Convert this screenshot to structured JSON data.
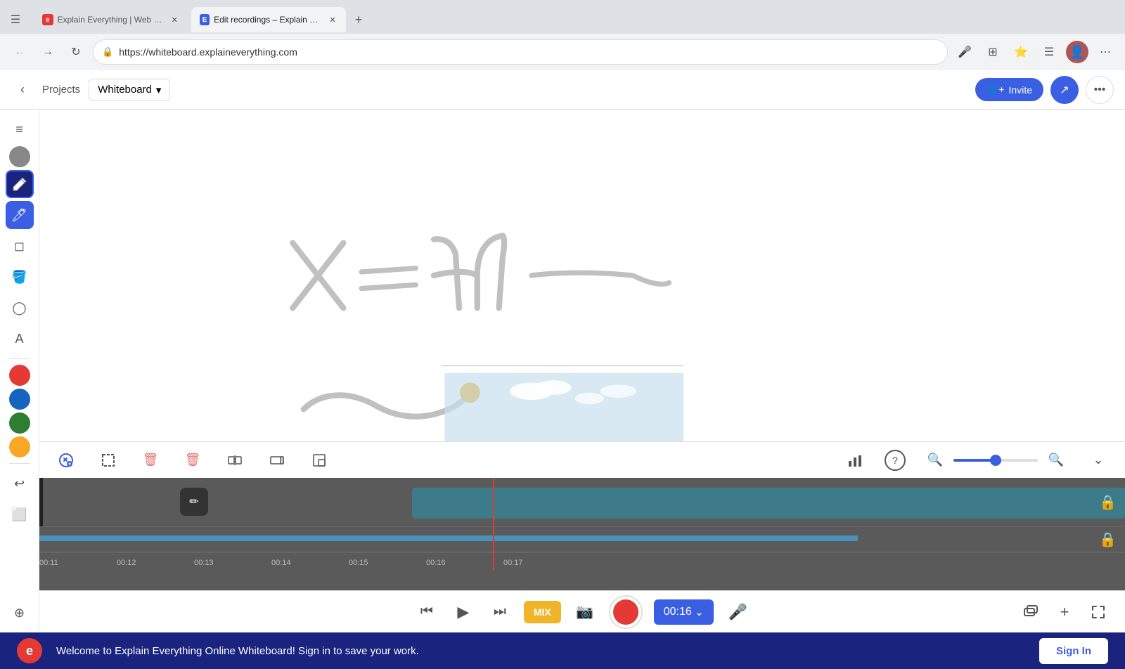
{
  "browser": {
    "tabs": [
      {
        "id": "tab1",
        "favicon_color": "#e53935",
        "title": "Explain Everything | Web W...",
        "active": false
      },
      {
        "id": "tab2",
        "favicon_color": "#3b5fe3",
        "title": "Edit recordings – Explain Everyth",
        "active": true
      }
    ],
    "url": "https://whiteboard.explaineverything.com",
    "new_tab_label": "+"
  },
  "topbar": {
    "back_label": "‹",
    "projects_label": "Projects",
    "whiteboard_label": "Whiteboard",
    "invite_label": "Invite",
    "more_dots": "•••"
  },
  "toolbar": {
    "tools": [
      {
        "id": "grid",
        "icon": "⊞",
        "active": false
      },
      {
        "id": "hand",
        "icon": "✋",
        "active": false
      },
      {
        "id": "pen",
        "icon": "✏️",
        "active": false
      },
      {
        "id": "highlighter",
        "icon": "🖊",
        "active": true
      },
      {
        "id": "eraser",
        "icon": "◻",
        "active": false
      },
      {
        "id": "fill",
        "icon": "🪣",
        "active": false
      },
      {
        "id": "shape",
        "icon": "◯",
        "active": false
      },
      {
        "id": "text",
        "icon": "A",
        "active": false
      },
      {
        "id": "laser",
        "icon": "≡",
        "active": false
      },
      {
        "id": "undo",
        "icon": "↩",
        "active": false
      },
      {
        "id": "frame",
        "icon": "⬜",
        "active": false
      }
    ],
    "colors": [
      "#888888",
      "#1a237e",
      "#e53935",
      "#1565c0",
      "#2e7d32",
      "#f9a825"
    ]
  },
  "timeline_toolbar": {
    "tools": [
      {
        "id": "select",
        "icon": "⊙",
        "active": true
      },
      {
        "id": "marquee",
        "icon": "⬚",
        "active": false
      },
      {
        "id": "delete",
        "icon": "🗑",
        "active": false
      },
      {
        "id": "delete-all",
        "icon": "🗑",
        "active": false
      },
      {
        "id": "split",
        "icon": "⧉",
        "active": false
      },
      {
        "id": "trim",
        "icon": "⬕",
        "active": false
      },
      {
        "id": "crop",
        "icon": "◱",
        "active": false
      },
      {
        "id": "chart",
        "icon": "📊",
        "active": false
      },
      {
        "id": "help",
        "icon": "?",
        "active": false
      }
    ],
    "zoom_level": 50
  },
  "timeline": {
    "time_markers": [
      "00:11",
      "00:12",
      "00:13",
      "00:14",
      "00:15",
      "00:16",
      "00:17"
    ],
    "playhead_position": "00:16"
  },
  "transport": {
    "rewind_label": "⏮",
    "play_label": "▶",
    "forward_label": "⏭",
    "mix_label": "MIX",
    "time_display": "00:16",
    "dropdown_icon": "⌄"
  },
  "bottom_banner": {
    "message": "Welcome to Explain Everything Online Whiteboard! Sign in to save your work.",
    "sign_in_label": "Sign In"
  },
  "canvas": {
    "math_text": "x = η —~",
    "wave_drawing": true
  }
}
